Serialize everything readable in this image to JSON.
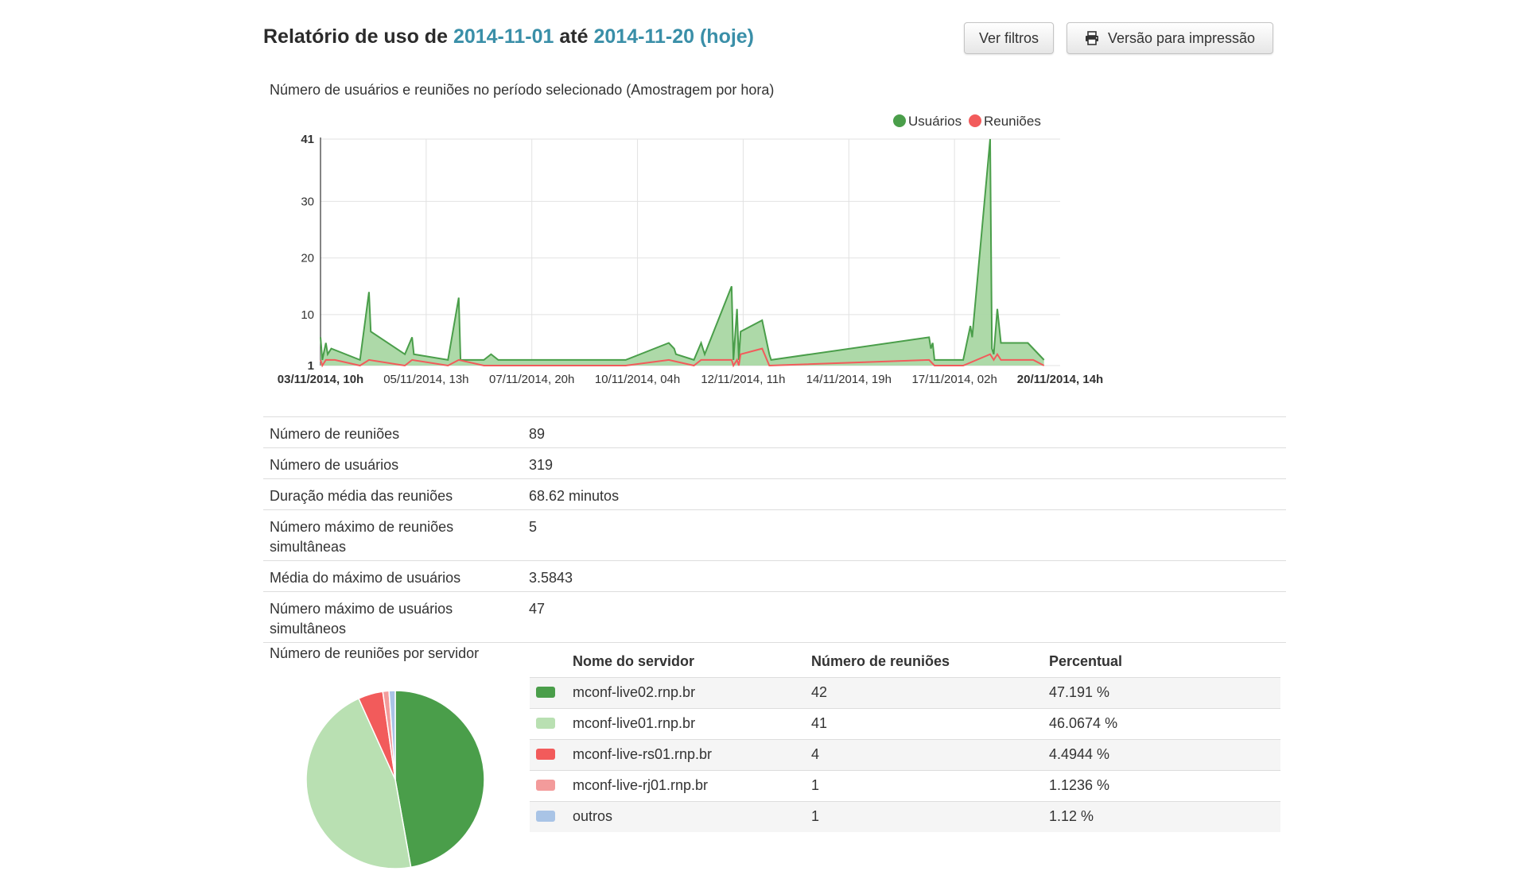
{
  "header": {
    "title_prefix": "Relatório de uso de",
    "start_date": "2014-11-01",
    "connector": "até",
    "end_date": "2014-11-20",
    "today_label": "(hoje)",
    "filters_button": "Ver filtros",
    "print_button": "Versão para impressão",
    "print_icon": "printer-icon"
  },
  "chart_data": {
    "type": "area",
    "title": "Número de usuários e reuniões no período selecionado (Amostragem por hora)",
    "legend_position": "top-right",
    "grid": true,
    "ylim": [
      1,
      41
    ],
    "y_ticks": [
      "1",
      "10",
      "20",
      "30",
      "41"
    ],
    "x_ticks": [
      "03/11/2014, 10h",
      "05/11/2014, 13h",
      "07/11/2014, 20h",
      "10/11/2014, 04h",
      "12/11/2014, 11h",
      "14/11/2014, 19h",
      "17/11/2014, 02h",
      "20/11/2014, 14h"
    ],
    "x_ticks_bold": [
      true,
      false,
      false,
      false,
      false,
      false,
      false,
      true
    ],
    "x_range_hours": [
      0,
      412
    ],
    "series": [
      {
        "name": "Usuários",
        "color": "#4a9e4a",
        "fill": "#a9d7a3",
        "points": [
          [
            0,
            6
          ],
          [
            1,
            2
          ],
          [
            3,
            5
          ],
          [
            4,
            3
          ],
          [
            6,
            4
          ],
          [
            22,
            2
          ],
          [
            27,
            14
          ],
          [
            28,
            7
          ],
          [
            47,
            3
          ],
          [
            51,
            6
          ],
          [
            52,
            3
          ],
          [
            71,
            2
          ],
          [
            77,
            13
          ],
          [
            78,
            2
          ],
          [
            91,
            2
          ],
          [
            95,
            3
          ],
          [
            99,
            2
          ],
          [
            170,
            2
          ],
          [
            194,
            5
          ],
          [
            197,
            4
          ],
          [
            198,
            3
          ],
          [
            208,
            2
          ],
          [
            212,
            5
          ],
          [
            213,
            4
          ],
          [
            214,
            3
          ],
          [
            229,
            15
          ],
          [
            230,
            2
          ],
          [
            232,
            11
          ],
          [
            233,
            2
          ],
          [
            234,
            7
          ],
          [
            246,
            9
          ],
          [
            250,
            3
          ],
          [
            251,
            2
          ],
          [
            339,
            6
          ],
          [
            340,
            4
          ],
          [
            341,
            5
          ],
          [
            342,
            2
          ],
          [
            358,
            2
          ],
          [
            362,
            8
          ],
          [
            363,
            6
          ],
          [
            373,
            41
          ],
          [
            374,
            4
          ],
          [
            375,
            3
          ],
          [
            377,
            11
          ],
          [
            379,
            5
          ],
          [
            394,
            5
          ],
          [
            397,
            4
          ],
          [
            403,
            2
          ]
        ]
      },
      {
        "name": "Reuniões",
        "color": "#f25b5b",
        "points": [
          [
            0,
            2
          ],
          [
            1,
            1
          ],
          [
            3,
            2
          ],
          [
            8,
            2
          ],
          [
            22,
            1
          ],
          [
            27,
            2
          ],
          [
            47,
            1
          ],
          [
            51,
            2
          ],
          [
            71,
            1
          ],
          [
            77,
            2
          ],
          [
            91,
            1
          ],
          [
            99,
            1
          ],
          [
            170,
            1
          ],
          [
            194,
            2
          ],
          [
            208,
            1
          ],
          [
            212,
            2
          ],
          [
            229,
            2
          ],
          [
            230,
            1
          ],
          [
            232,
            2
          ],
          [
            233,
            1
          ],
          [
            234,
            3
          ],
          [
            246,
            4
          ],
          [
            250,
            1
          ],
          [
            339,
            2
          ],
          [
            342,
            1
          ],
          [
            358,
            1
          ],
          [
            373,
            3
          ],
          [
            375,
            2
          ],
          [
            377,
            3
          ],
          [
            379,
            2
          ],
          [
            394,
            2
          ],
          [
            397,
            2
          ],
          [
            403,
            1
          ]
        ]
      }
    ]
  },
  "stats": [
    {
      "label": "Número de reuniões",
      "value": "89"
    },
    {
      "label": "Número de usuários",
      "value": "319"
    },
    {
      "label": "Duração média das reuniões",
      "value": "68.62 minutos"
    },
    {
      "label": "Número máximo de reuniões simultâneas",
      "value": "5"
    },
    {
      "label": "Média do máximo de usuários",
      "value": "3.5843"
    },
    {
      "label": "Número máximo de usuários simultâneos",
      "value": "47"
    }
  ],
  "servers_section": {
    "caption": "Número de reuniões por servidor",
    "col_name": "Nome do servidor",
    "col_count": "Número de reuniões",
    "col_pct": "Percentual",
    "rows": [
      {
        "name": "mconf-live02.rnp.br",
        "count": "42",
        "pct": "47.191 %",
        "color": "#4a9e4a",
        "value": 42
      },
      {
        "name": "mconf-live01.rnp.br",
        "count": "41",
        "pct": "46.0674 %",
        "color": "#b9e0b2",
        "value": 41
      },
      {
        "name": "mconf-live-rs01.rnp.br",
        "count": "4",
        "pct": "4.4944 %",
        "color": "#f25b5b",
        "value": 4
      },
      {
        "name": "mconf-live-rj01.rnp.br",
        "count": "1",
        "pct": "1.1236 %",
        "color": "#f39b9b",
        "value": 1
      },
      {
        "name": "outros",
        "count": "1",
        "pct": "1.12 %",
        "color": "#a9c4e6",
        "value": 1
      }
    ]
  }
}
